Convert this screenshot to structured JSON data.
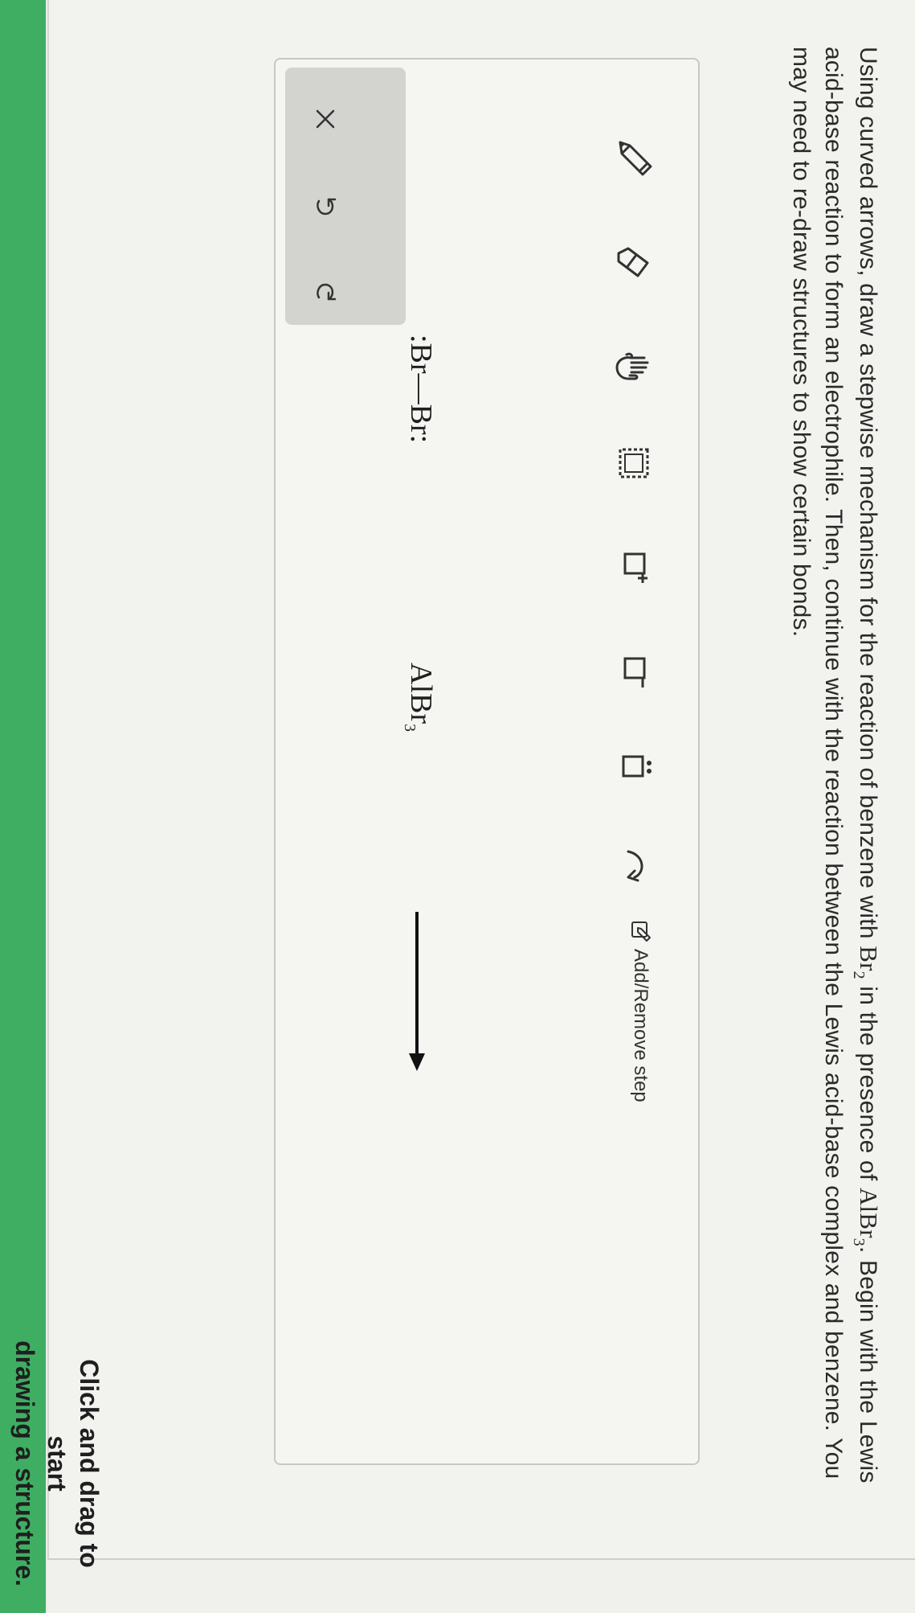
{
  "question": {
    "part1": "Using curved arrows, draw a stepwise mechanism for the reaction of benzene with ",
    "br2_main": "Br",
    "br2_sub": "2",
    "part2": " in the presence of ",
    "albr3_main": "AlBr",
    "albr3_sub": "3",
    "part3": ". Begin with the Lewis acid-base reaction to form an electrophile. Then, continue with the reaction between the Lewis acid-base complex and benzene. You may need to re-draw structures to show certain bonds."
  },
  "toolbar": {
    "add_remove_label": "Add/Remove step",
    "charge_plus": "+",
    "charge_minus": "−"
  },
  "drawing": {
    "reactant1_left": ":Br",
    "reactant1_bond": "—",
    "reactant1_right": "Br:",
    "reactant2_main": "AlBr",
    "reactant2_sub": "3"
  },
  "hint": {
    "line1": "Click and drag to start",
    "line2": "drawing a structure."
  },
  "colors": {
    "accent_green": "#3fae63",
    "panel_gray": "#d3d3d0"
  }
}
